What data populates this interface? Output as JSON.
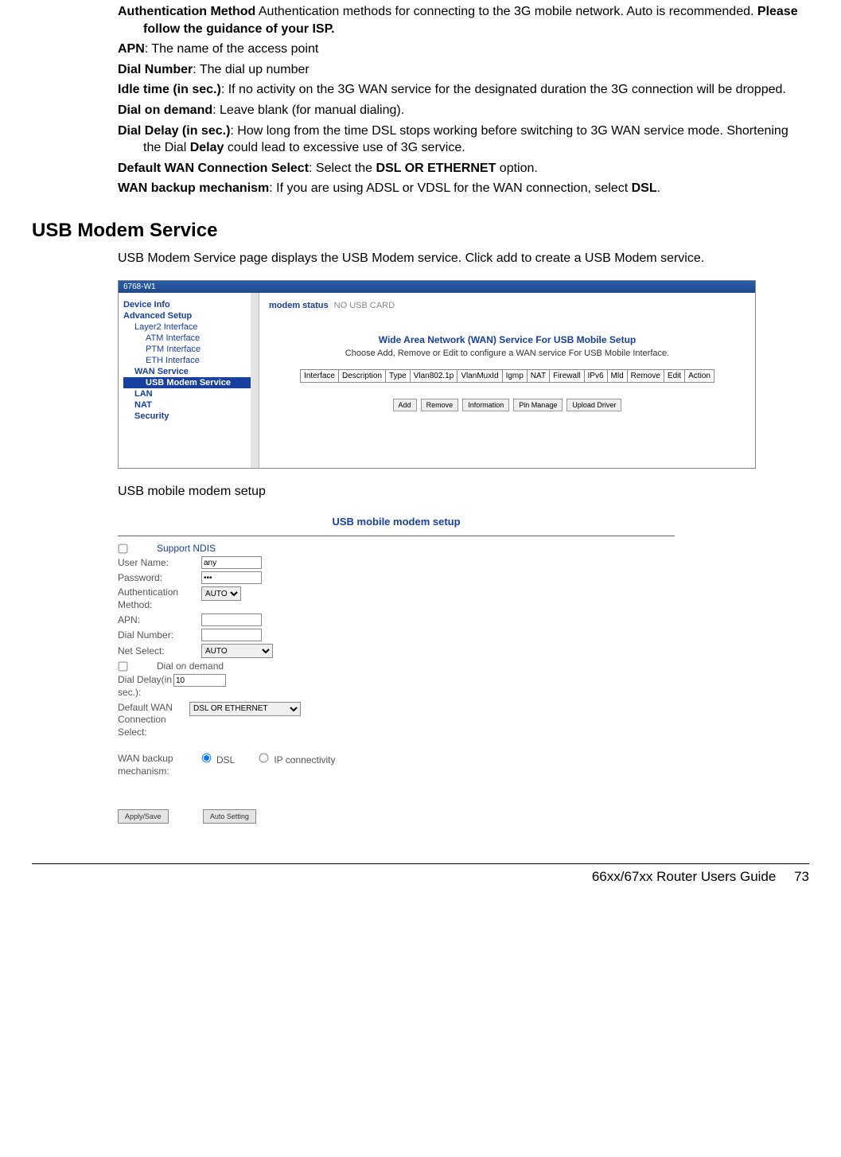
{
  "defs": {
    "auth": {
      "term": "Authentication Method",
      "text_a": " Authentication methods for connecting to the 3G mobile network. Auto is recommended. ",
      "bold_tail": "Please follow the guidance of your ISP."
    },
    "apn": {
      "term": "APN",
      "text": ": The name of the access point"
    },
    "dialn": {
      "term": "Dial Number",
      "text": ": The dial up number"
    },
    "idle": {
      "term": "Idle time (in sec.)",
      "text": ": If no activity on the 3G WAN service for the designated duration the 3G connection will be dropped."
    },
    "dod": {
      "term": "Dial on demand",
      "text": ": Leave blank (for manual dialing)."
    },
    "delay": {
      "term": "Dial Delay (in sec.)",
      "text_a": ": How long from the time DSL stops working before switching to 3G WAN service mode. Shortening the Dial ",
      "bold_mid": "Delay",
      "text_b": " could lead to excessive use of 3G service."
    },
    "defwan": {
      "term": "Default WAN Connection Select",
      "text_a": ": Select the ",
      "bold_mid": "DSL OR ETHERNET",
      "text_b": " option."
    },
    "backup": {
      "term": "WAN backup mechanism",
      "text_a": ": If you are using ADSL or VDSL for the WAN connection, select ",
      "bold_mid": "DSL",
      "text_b": "."
    }
  },
  "section_heading": "USB Modem Service",
  "section_para": "USB Modem Service page displays the USB Modem service. Click add to create a USB Modem service.",
  "caption2": "USB mobile modem setup",
  "fig1": {
    "titlebar": "6768-W1",
    "nav": {
      "device_info": "Device Info",
      "adv_setup": "Advanced Setup",
      "l2": "Layer2 Interface",
      "atm": "ATM Interface",
      "ptm": "PTM Interface",
      "eth": "ETH Interface",
      "wan": "WAN Service",
      "usb": "USB Modem Service",
      "lan": "LAN",
      "nat": "NAT",
      "sec": "Security"
    },
    "status_label": "modem status",
    "status_value": "NO USB CARD",
    "main_heading": "Wide Area Network (WAN) Service For USB Mobile Setup",
    "main_sub": "Choose Add, Remove or Edit to configure a WAN service For USB Mobile Interface.",
    "cols": [
      "Interface",
      "Description",
      "Type",
      "Vlan802.1p",
      "VlanMuxId",
      "Igmp",
      "NAT",
      "Firewall",
      "IPv6",
      "Mld",
      "Remove",
      "Edit",
      "Action"
    ],
    "buttons": [
      "Add",
      "Remove",
      "Information",
      "Pin Manage",
      "Upload Driver"
    ]
  },
  "fig2": {
    "title": "USB mobile modem setup",
    "support_ndis": "Support NDIS",
    "username_lbl": "User Name:",
    "username_val": "any",
    "password_lbl": "Password:",
    "password_val": "•••",
    "auth_lbl": "Authentication Method:",
    "auth_val": "AUTO",
    "apn_lbl": "APN:",
    "dialn_lbl": "Dial Number:",
    "net_lbl": "Net Select:",
    "net_val": "AUTO",
    "dod_lbl": "Dial on demand",
    "delay_lbl": "Dial Delay(in sec.):",
    "delay_val": "10",
    "defwan_lbl": "Default WAN Connection Select:",
    "defwan_val": "DSL OR ETHERNET",
    "backup_lbl": "WAN backup mechanism:",
    "radio_dsl": "DSL",
    "radio_ip": "IP connectivity",
    "btn_apply": "Apply/Save",
    "btn_auto": "Auto Setting"
  },
  "footer": {
    "guide": "66xx/67xx Router Users Guide",
    "page": "73"
  }
}
